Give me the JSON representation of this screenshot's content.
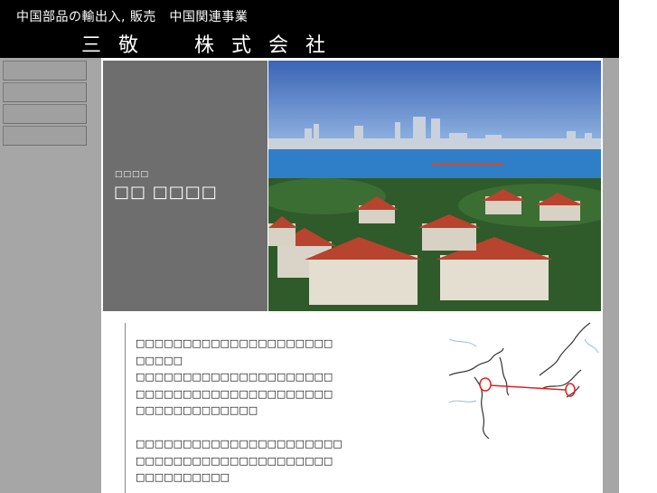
{
  "header": {
    "tagline": "中国部品の輸出入, 販売　中国関連事業",
    "company_name": "三 敬　　株 式 会 社"
  },
  "sidebar": {
    "nav_items": [
      {
        "label": ""
      },
      {
        "label": ""
      },
      {
        "label": ""
      },
      {
        "label": ""
      }
    ]
  },
  "banner": {
    "ruby_text": "□□□□",
    "title": "□□ □□□□",
    "photo_alt": "coastal city photo",
    "colors": {
      "panel": "#6e6e6e",
      "sky": "#3a64b6",
      "sea": "#2e7fc8",
      "roofs": "#b8432f"
    }
  },
  "content": {
    "paragraphs": [
      "□□□□□□□□□□□□□□□□□□□□□",
      "□□□□□",
      "□□□□□□□□□□□□□□□□□□□□□",
      "□□□□□□□□□□□□□□□□□□□□□",
      "□□□□□□□□□□□□□",
      "",
      "□□□□□□□□□□□□□□□□□□□□□□",
      "□□□□□□□□□□□□□□□□□□□□□",
      "□□□□□□□□□□"
    ]
  },
  "map": {
    "alt": "map of China and Japan with route",
    "route_color": "#e02020"
  }
}
